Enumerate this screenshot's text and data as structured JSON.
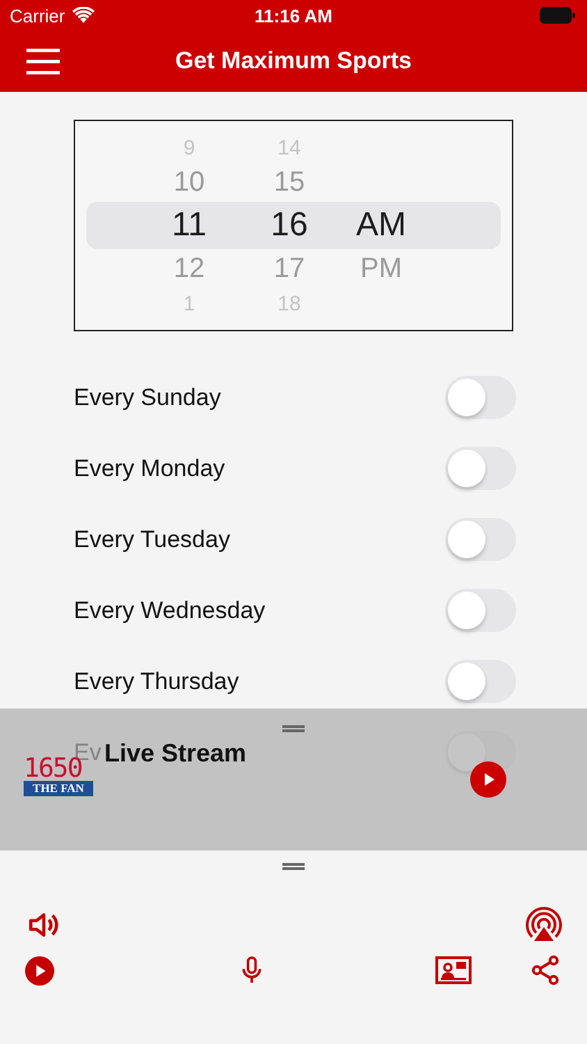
{
  "status_bar": {
    "carrier": "Carrier",
    "time": "11:16 AM"
  },
  "nav_bar": {
    "title": "Get Maximum Sports"
  },
  "time_picker": {
    "hours": [
      {
        "text": "9",
        "selected": false
      },
      {
        "text": "10",
        "selected": false
      },
      {
        "text": "11",
        "selected": true
      },
      {
        "text": "12",
        "selected": false
      },
      {
        "text": "1",
        "selected": false
      }
    ],
    "minutes": [
      {
        "text": "14",
        "selected": false
      },
      {
        "text": "15",
        "selected": false
      },
      {
        "text": "16",
        "selected": true
      },
      {
        "text": "17",
        "selected": false
      },
      {
        "text": "18",
        "selected": false
      }
    ],
    "periods": [
      {
        "text": "AM",
        "selected": true
      },
      {
        "text": "PM",
        "selected": false
      }
    ]
  },
  "days": [
    {
      "label": "Every Sunday",
      "on": false
    },
    {
      "label": "Every Monday",
      "on": false
    },
    {
      "label": "Every Tuesday",
      "on": false
    },
    {
      "label": "Every Wednesday",
      "on": false
    },
    {
      "label": "Every Thursday",
      "on": false
    },
    {
      "label": "Ev",
      "on": false
    }
  ],
  "now_playing": {
    "logo_number": "1650",
    "logo_name": "THE FAN",
    "title": "Live Stream"
  }
}
